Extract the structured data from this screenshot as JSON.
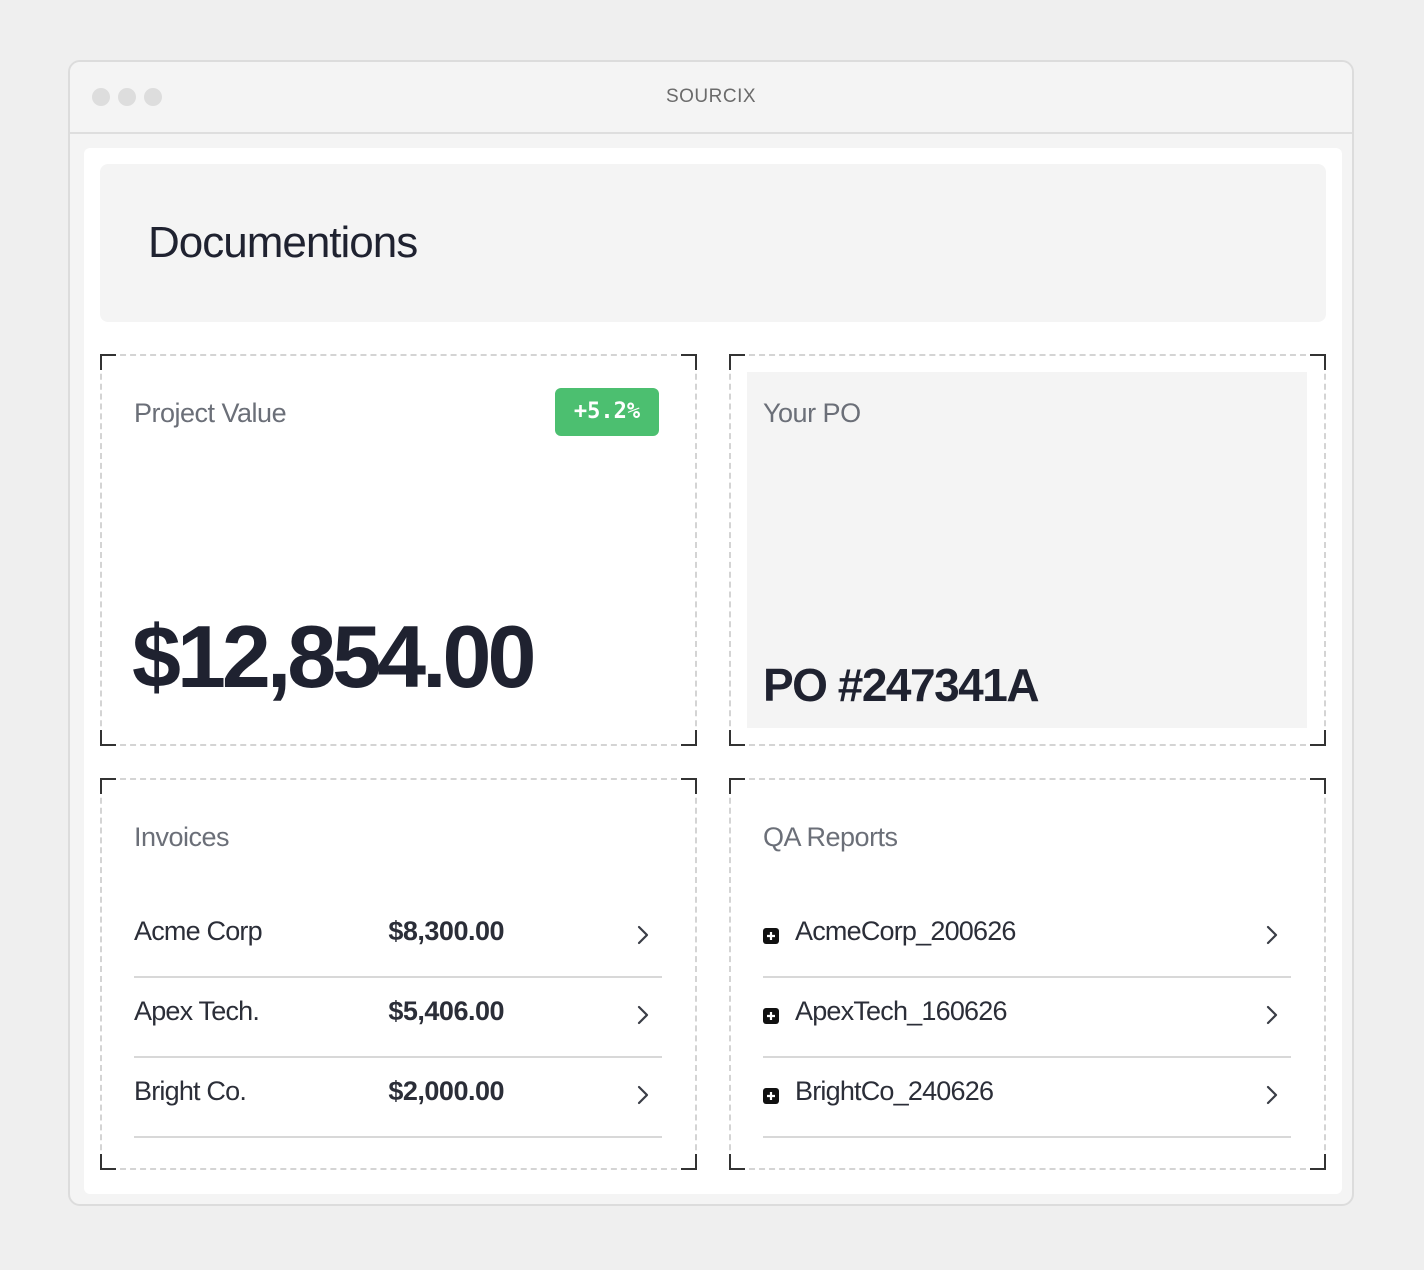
{
  "window": {
    "title": "SOURCIX"
  },
  "header": {
    "title": "Documentions"
  },
  "project_value": {
    "label": "Project Value",
    "change_badge": "+5.2%",
    "amount": "$12,854.00",
    "badge_color": "#4cbf70"
  },
  "po": {
    "label": "Your PO",
    "number": "PO #247341A"
  },
  "invoices": {
    "label": "Invoices",
    "items": [
      {
        "name": "Acme Corp",
        "amount": "$8,300.00"
      },
      {
        "name": "Apex Tech.",
        "amount": "$5,406.00"
      },
      {
        "name": "Bright Co.",
        "amount": "$2,000.00"
      }
    ]
  },
  "qa_reports": {
    "label": "QA Reports",
    "items": [
      {
        "file": "AcmeCorp_200626"
      },
      {
        "file": "ApexTech_160626"
      },
      {
        "file": "BrightCo_240626"
      }
    ]
  }
}
